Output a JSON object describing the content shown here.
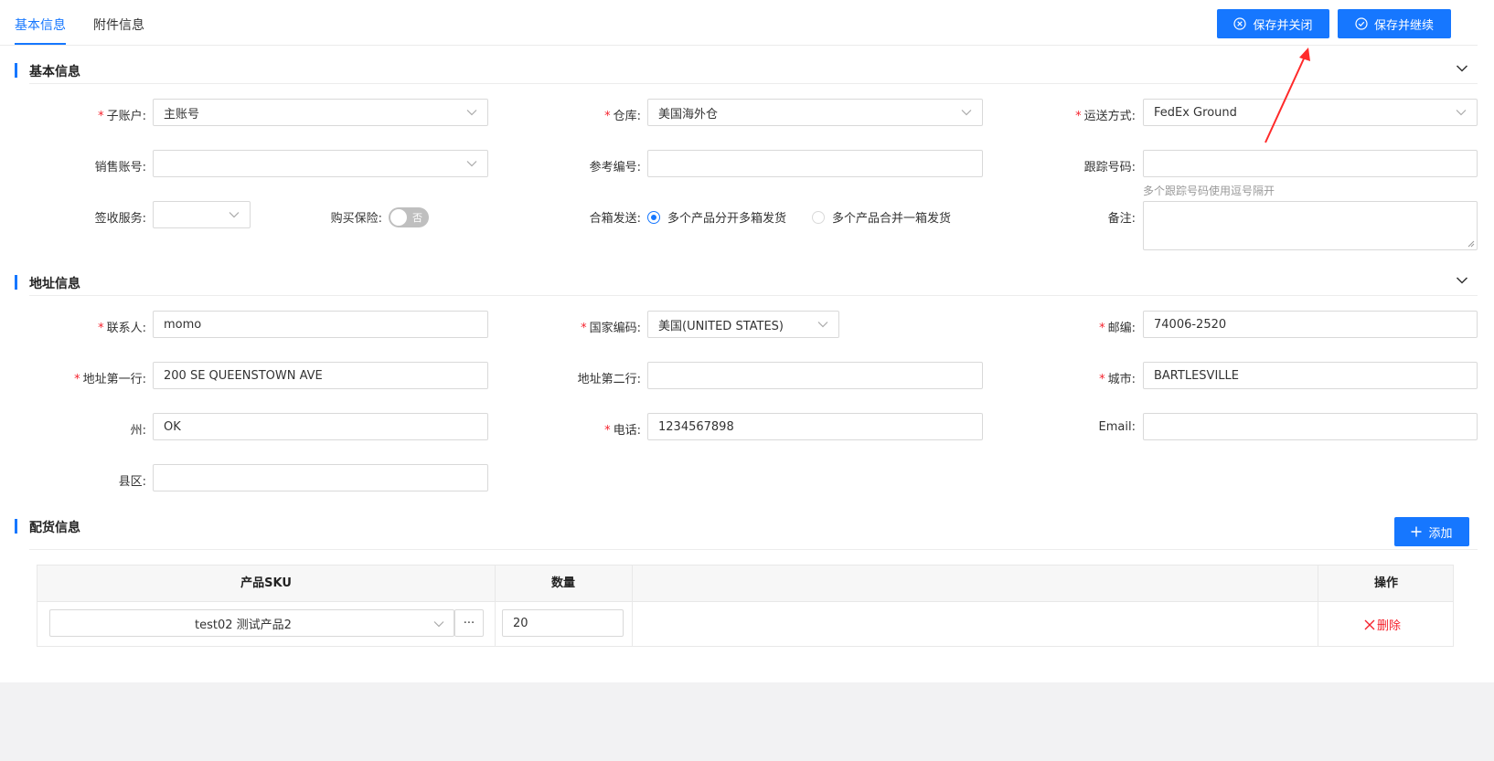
{
  "tabs": [
    {
      "label": "基本信息",
      "active": true
    },
    {
      "label": "附件信息",
      "active": false
    }
  ],
  "actions": {
    "save_close": "保存并关闭",
    "save_continue": "保存并继续"
  },
  "sections": {
    "basic": "基本信息",
    "address": "地址信息",
    "allocation": "配货信息"
  },
  "basic": {
    "sub_account": {
      "label": "子账户:",
      "value": "主账号",
      "required": true
    },
    "warehouse": {
      "label": "仓库:",
      "value": "美国海外仓",
      "required": true
    },
    "shipping_method": {
      "label": "运送方式:",
      "value": "FedEx Ground",
      "required": true
    },
    "sales_account": {
      "label": "销售账号:",
      "value": ""
    },
    "reference_no": {
      "label": "参考编号:",
      "value": ""
    },
    "tracking_no": {
      "label": "跟踪号码:",
      "value": "",
      "hint": "多个跟踪号码使用逗号隔开"
    },
    "signature_service": {
      "label": "签收服务:",
      "value": ""
    },
    "insurance": {
      "label": "购买保险:",
      "switch_text": "否",
      "on": false
    },
    "combine_shipping": {
      "label": "合箱发送:",
      "options": [
        {
          "label": "多个产品分开多箱发货",
          "checked": true
        },
        {
          "label": "多个产品合并一箱发货",
          "checked": false
        }
      ]
    },
    "remarks": {
      "label": "备注:",
      "value": ""
    }
  },
  "address": {
    "contact": {
      "label": "联系人:",
      "value": "momo",
      "required": true
    },
    "country_code": {
      "label": "国家编码:",
      "value": "美国(UNITED STATES)",
      "required": true
    },
    "postcode": {
      "label": "邮编:",
      "value": "74006-2520",
      "required": true
    },
    "address1": {
      "label": "地址第一行:",
      "value": "200 SE QUEENSTOWN AVE",
      "required": true
    },
    "address2": {
      "label": "地址第二行:",
      "value": ""
    },
    "city": {
      "label": "城市:",
      "value": "BARTLESVILLE",
      "required": true
    },
    "state": {
      "label": "州:",
      "value": "OK"
    },
    "phone": {
      "label": "电话:",
      "value": "1234567898",
      "required": true
    },
    "email": {
      "label": "Email:",
      "value": ""
    },
    "county": {
      "label": "县区:",
      "value": ""
    }
  },
  "allocation": {
    "add_label": "添加",
    "columns": [
      "产品SKU",
      "数量",
      "",
      "操作"
    ],
    "rows": [
      {
        "sku": "test02 测试产品2",
        "more": "···",
        "quantity": "20",
        "delete": "删除"
      }
    ]
  },
  "required_mark": "*",
  "colors": {
    "primary": "#1677ff",
    "danger": "#f5222d",
    "annotation": "#ff2a2a"
  }
}
